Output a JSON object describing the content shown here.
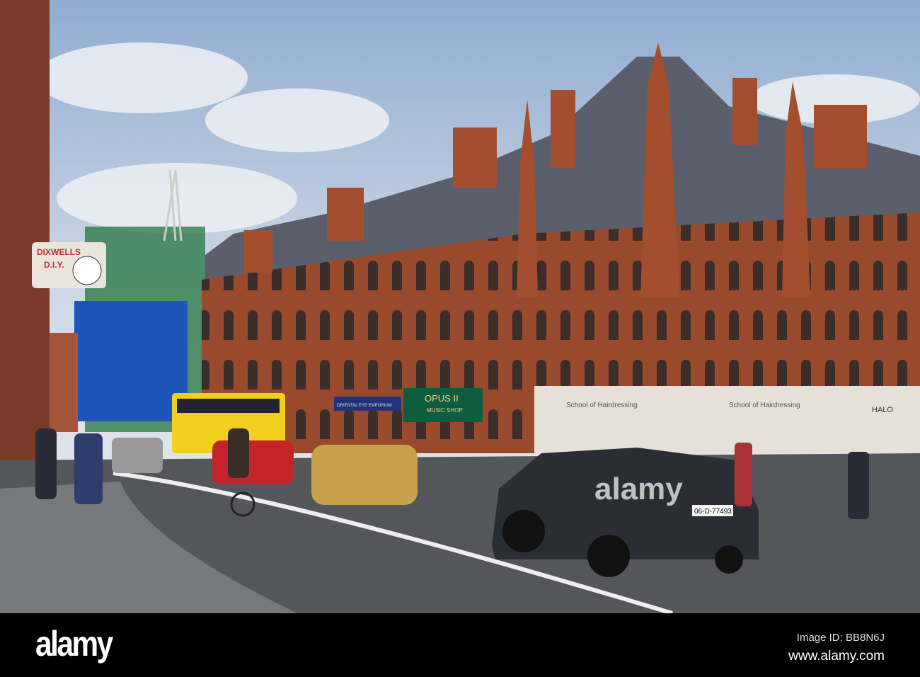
{
  "photo": {
    "signs": {
      "diy_shop_line1": "DIXWELLS",
      "diy_shop_line2": "D.I.Y.",
      "music_shop_name": "OPUS II",
      "music_shop_sub": "MUSIC SHOP",
      "emporium": "ORIENTAL EYE EMPORIUM",
      "hairdresser_1": "School of Hairdressing",
      "hairdresser_2": "School of Hairdressing",
      "halo": "HALO",
      "license_plate": "06-D-77493"
    },
    "watermark": "alamy"
  },
  "footer": {
    "logo": "alamy",
    "image_id": "Image ID: BB8N6J",
    "url": "www.alamy.com"
  },
  "colors": {
    "sky": "#b9cbe0",
    "brick": "#9a4a2c",
    "roof": "#5a5f6b",
    "road": "#55565a",
    "footer": "#000000"
  }
}
